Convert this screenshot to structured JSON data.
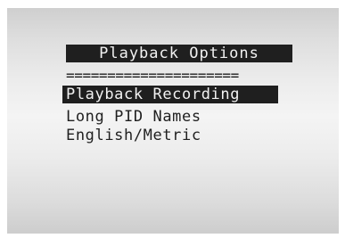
{
  "screen": {
    "title": "Playback Options",
    "divider": "=====================",
    "menu_items": [
      {
        "label": "Playback Recording",
        "selected": true
      },
      {
        "label": "Long PID Names",
        "selected": false
      },
      {
        "label": "English/Metric",
        "selected": false
      }
    ]
  },
  "colors": {
    "text": "#1f1f1f",
    "highlight_bg": "#1f1f1f",
    "highlight_text": "#f2f2f2",
    "screen_bg": "#e9e9e9"
  }
}
